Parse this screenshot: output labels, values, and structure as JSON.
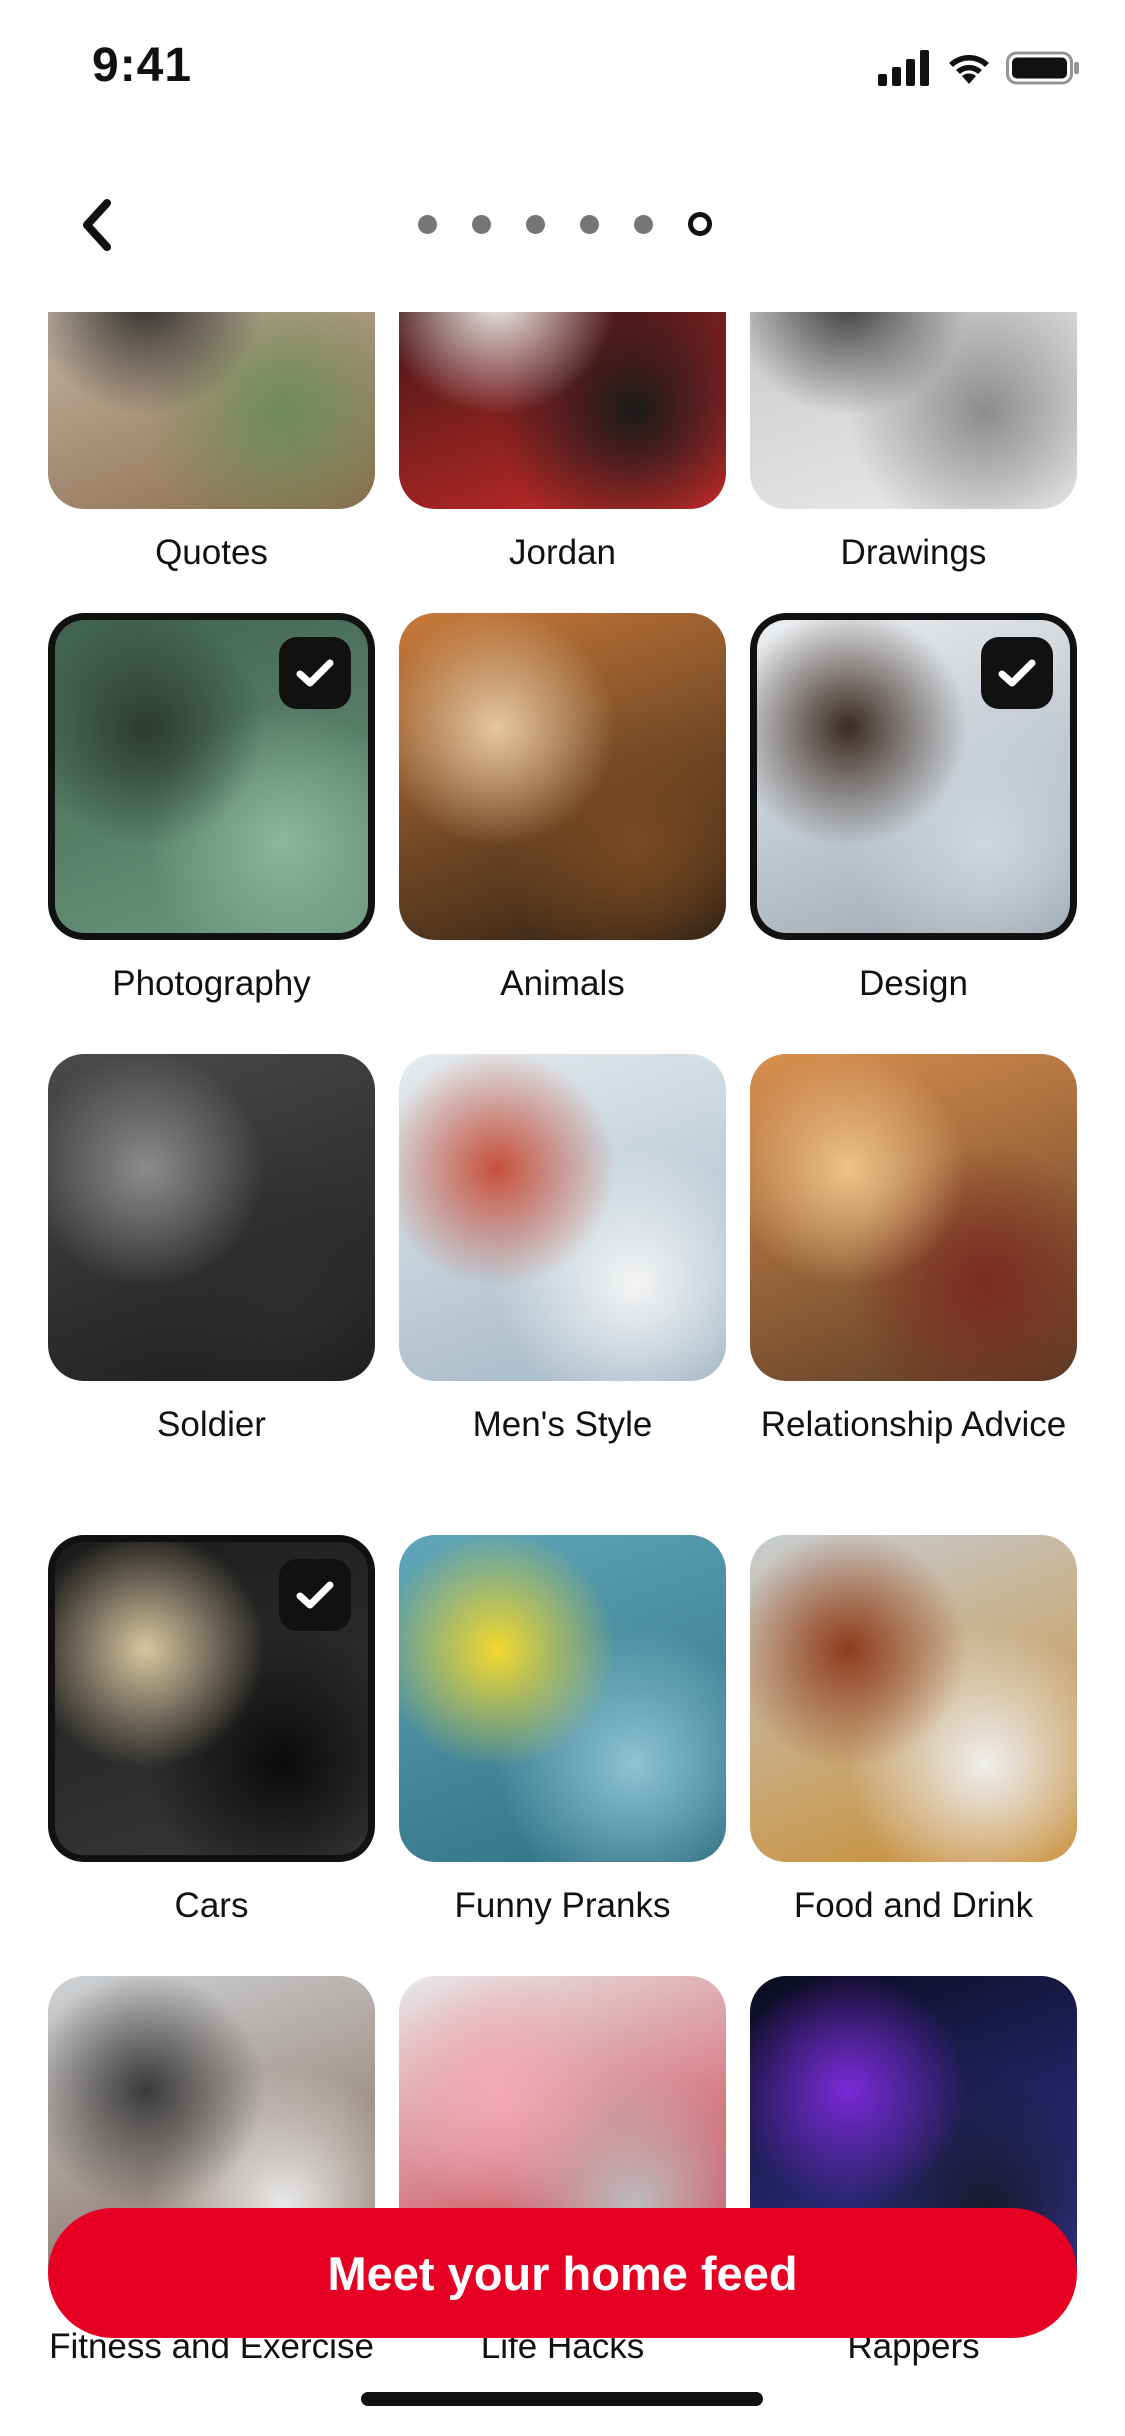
{
  "status_bar": {
    "time": "9:41",
    "signal_icon": "signal-bars-icon",
    "wifi_icon": "wifi-icon",
    "battery_icon": "battery-icon"
  },
  "header": {
    "back_icon": "chevron-left-icon",
    "progress": {
      "total_steps": 6,
      "current_step": 6
    }
  },
  "topics": [
    {
      "label": "Quotes",
      "selected": false,
      "colors": [
        "#d9d2c6",
        "#8a6a4a",
        "#2b2b2b",
        "#6e8b5a"
      ]
    },
    {
      "label": "Jordan",
      "selected": false,
      "colors": [
        "#0d0d0d",
        "#cf2b2b",
        "#f2f2f2",
        "#1a1a1a"
      ]
    },
    {
      "label": "Drawings",
      "selected": false,
      "colors": [
        "#bdbdbd",
        "#ececec",
        "#3a3a3a",
        "#8c8c8c"
      ]
    },
    {
      "label": "Photography",
      "selected": true,
      "colors": [
        "#3f5f4f",
        "#6e9a82",
        "#2a3b32",
        "#8fb59f"
      ]
    },
    {
      "label": "Animals",
      "selected": false,
      "colors": [
        "#c97a3a",
        "#2a1e14",
        "#e6c7a0",
        "#7a4a22"
      ]
    },
    {
      "label": "Design",
      "selected": true,
      "colors": [
        "#eef0f2",
        "#9aa6b1",
        "#3b2a22",
        "#cfd6dc"
      ]
    },
    {
      "label": "Soldier",
      "selected": false,
      "colors": [
        "#4a4a4a",
        "#1c1c1c",
        "#8c8c8c",
        "#2e2e2e"
      ]
    },
    {
      "label": "Men's Style",
      "selected": false,
      "colors": [
        "#e6ebee",
        "#9fb5c4",
        "#c7503c",
        "#f4f4f4"
      ]
    },
    {
      "label": "Relationship Advice",
      "selected": false,
      "colors": [
        "#d9904e",
        "#5a3a25",
        "#f0c28a",
        "#7a2a22"
      ]
    },
    {
      "label": "Cars",
      "selected": true,
      "colors": [
        "#1a1a1a",
        "#3a3a3a",
        "#d8c6a0",
        "#0a0a0a"
      ]
    },
    {
      "label": "Funny Pranks",
      "selected": false,
      "colors": [
        "#5fa6b8",
        "#2f6f82",
        "#f2d92e",
        "#8cc4d2"
      ]
    },
    {
      "label": "Food and Drink",
      "selected": false,
      "colors": [
        "#c8cdd1",
        "#c98a2e",
        "#8f3b1c",
        "#eeeeee"
      ]
    },
    {
      "label": "Fitness and Exercise",
      "selected": false,
      "colors": [
        "#cfd3d6",
        "#7a5e4e",
        "#3a3a3a",
        "#e9e9e9"
      ]
    },
    {
      "label": "Life Hacks",
      "selected": false,
      "colors": [
        "#e8e8ea",
        "#c81e2a",
        "#f3a9b6",
        "#bcbcc0"
      ]
    },
    {
      "label": "Rappers",
      "selected": false,
      "colors": [
        "#0b0b1e",
        "#3a3aa8",
        "#7a2ad8",
        "#1a1a2e"
      ]
    }
  ],
  "selected_icon": "checkmark-icon",
  "cta": {
    "label": "Meet your home feed",
    "color": "#e60023"
  }
}
